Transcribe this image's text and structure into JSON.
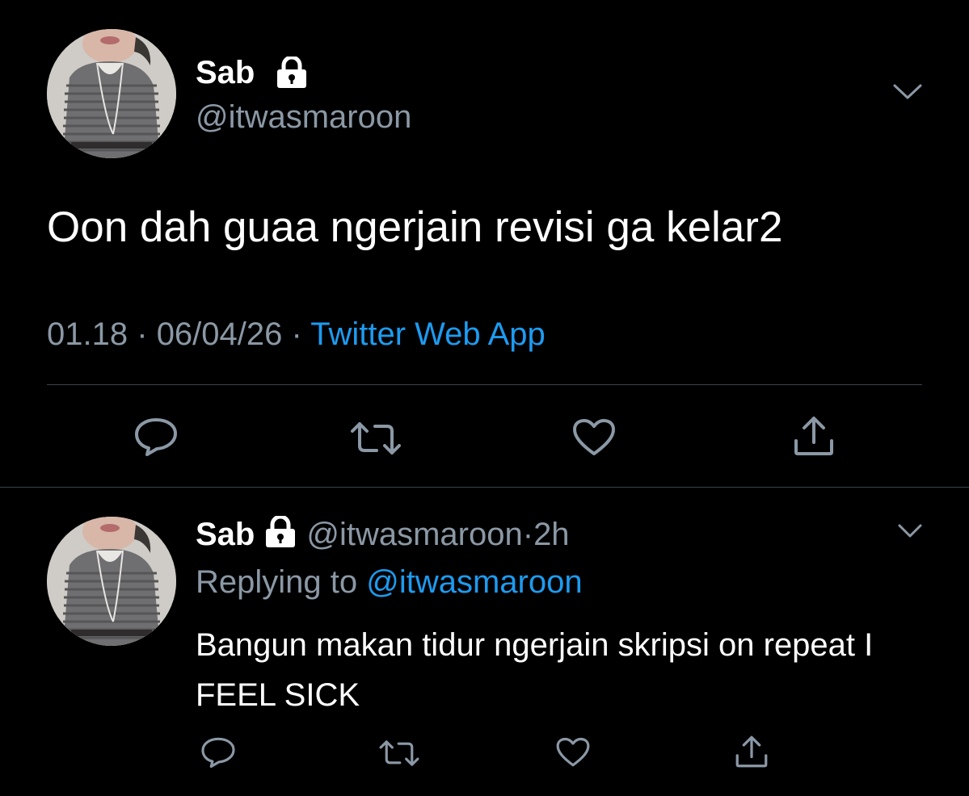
{
  "main_tweet": {
    "display_name": "Sab",
    "handle": "@itwasmaroon",
    "text": "Oon dah guaa ngerjain revisi ga kelar2",
    "time": "01.18",
    "date": "06/04/26",
    "separator": "·",
    "source": "Twitter Web App",
    "actions": {
      "reply": "reply-icon",
      "retweet": "retweet-icon",
      "like": "heart-icon",
      "share": "share-icon"
    }
  },
  "reply_tweet": {
    "display_name": "Sab",
    "handle": "@itwasmaroon",
    "separator": "·",
    "age": "2h",
    "replying_prefix": "Replying to",
    "replying_handle": "@itwasmaroon",
    "text": "Bangun makan tidur ngerjain skripsi on repeat I FEEL SICK"
  },
  "colors": {
    "background": "#000000",
    "text": "#ffffff",
    "secondary": "#8b98a5",
    "accent": "#1d9bf0",
    "divider": "#38444d"
  }
}
